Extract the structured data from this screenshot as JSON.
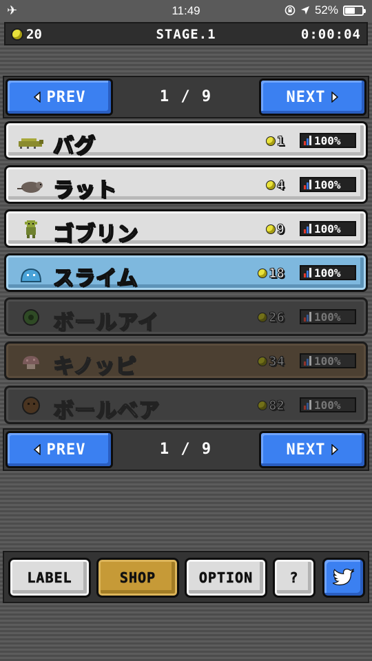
{
  "status_bar": {
    "time": "11:49",
    "battery": "52%"
  },
  "hud": {
    "coins": "20",
    "stage": "STAGE.1",
    "timer": "0:00:04"
  },
  "pager_top": {
    "prev_label": "PREV",
    "next_label": "NEXT",
    "page": "1 / 9"
  },
  "pager_bottom": {
    "prev_label": "PREV",
    "next_label": "NEXT",
    "page": "1 / 9"
  },
  "monsters": [
    {
      "name": "バグ",
      "price": "1",
      "rate": "100%",
      "state": "unlocked",
      "icon": "bug-icon"
    },
    {
      "name": "ラット",
      "price": "4",
      "rate": "100%",
      "state": "unlocked",
      "icon": "rat-icon"
    },
    {
      "name": "ゴブリン",
      "price": "9",
      "rate": "100%",
      "state": "unlocked",
      "icon": "goblin-icon"
    },
    {
      "name": "スライム",
      "price": "18",
      "rate": "100%",
      "state": "selected",
      "icon": "slime-icon"
    },
    {
      "name": "ボールアイ",
      "price": "26",
      "rate": "100%",
      "state": "locked",
      "icon": "ball-eye-icon"
    },
    {
      "name": "キノッピ",
      "price": "34",
      "rate": "100%",
      "state": "locked",
      "icon": "mushroom-icon"
    },
    {
      "name": "ボールベア",
      "price": "82",
      "rate": "100%",
      "state": "locked",
      "icon": "ball-bear-icon"
    }
  ],
  "footer": {
    "label_button": "LABEL",
    "shop_button": "SHOP",
    "option_button": "OPTION",
    "help_button": "?"
  },
  "colors": {
    "accent_blue": "#3b80f1",
    "shop_gold": "#c69a37",
    "selected_row": "#7eb8de",
    "coin_yellow": "#e9e23b"
  }
}
